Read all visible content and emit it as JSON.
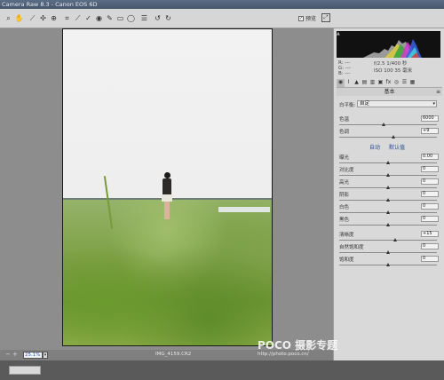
{
  "window": {
    "title": "Camera Raw 8.3  -  Canon EOS 6D"
  },
  "toolbar": {
    "tools": [
      {
        "icon": "zoom-icon",
        "glyph": "⌕"
      },
      {
        "icon": "hand-icon",
        "glyph": "✋"
      },
      {
        "icon": "white-balance-icon",
        "glyph": "⟋"
      },
      {
        "icon": "color-sampler-icon",
        "glyph": "✣"
      },
      {
        "icon": "target-adjust-icon",
        "glyph": "⊕"
      },
      {
        "icon": "crop-icon",
        "glyph": "⌗"
      },
      {
        "icon": "straighten-icon",
        "glyph": "⟋"
      },
      {
        "icon": "spot-removal-icon",
        "glyph": "✓"
      },
      {
        "icon": "red-eye-icon",
        "glyph": "◉"
      },
      {
        "icon": "adjustment-brush-icon",
        "glyph": "✎"
      },
      {
        "icon": "graduated-filter-icon",
        "glyph": "▭"
      },
      {
        "icon": "radial-filter-icon",
        "glyph": "◯"
      },
      {
        "icon": "preferences-icon",
        "glyph": "☰"
      },
      {
        "icon": "rotate-left-icon",
        "glyph": "↺"
      },
      {
        "icon": "rotate-right-icon",
        "glyph": "↻"
      }
    ],
    "preview_label": "预览",
    "preview_checked": true
  },
  "canvas": {
    "zoom_value": "25.1%",
    "filename": "IMG_4159.CR2"
  },
  "rgb": {
    "r_label": "R:",
    "g_label": "G:",
    "b_label": "B:",
    "r_val": "---",
    "g_val": "---",
    "b_val": "---"
  },
  "camera_info": {
    "line1": "f/2.5    1/400 秒",
    "line2": "ISO 100    35 毫米"
  },
  "panel": {
    "title": "基本",
    "white_balance_label": "白平衡:",
    "white_balance_value": "自定",
    "auto_label": "自动",
    "default_label": "默认值"
  },
  "sliders": [
    {
      "label": "色温",
      "value": "6000",
      "pos": 0.45
    },
    {
      "label": "色调",
      "value": "+9",
      "pos": 0.55
    },
    {
      "label": "曝光",
      "value": "0.00",
      "pos": 0.5
    },
    {
      "label": "对比度",
      "value": "0",
      "pos": 0.5
    },
    {
      "label": "高光",
      "value": "0",
      "pos": 0.5
    },
    {
      "label": "阴影",
      "value": "0",
      "pos": 0.5
    },
    {
      "label": "白色",
      "value": "0",
      "pos": 0.5
    },
    {
      "label": "黑色",
      "value": "0",
      "pos": 0.5
    },
    {
      "label": "清晰度",
      "value": "+15",
      "pos": 0.57
    },
    {
      "label": "自然饱和度",
      "value": "0",
      "pos": 0.5
    },
    {
      "label": "饱和度",
      "value": "0",
      "pos": 0.5
    }
  ],
  "watermark": {
    "brand": "POCO 摄影专题",
    "url": "http://photo.poco.cn/"
  }
}
